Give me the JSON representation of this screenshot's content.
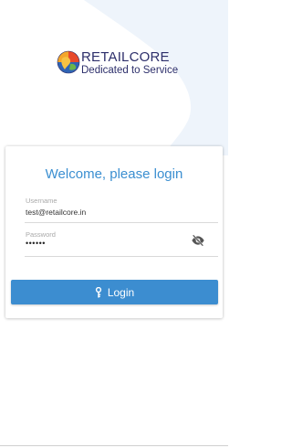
{
  "brand": {
    "name": "RETAILCORE",
    "tagline": "Dedicated to Service"
  },
  "login": {
    "title": "Welcome, please login",
    "username_label": "Username",
    "username_value": "test@retailcore.in",
    "password_label": "Password",
    "password_masked": "••••••",
    "button_label": "Login"
  },
  "icons": {
    "logo": "retailcore-globe-logo",
    "visibility_toggle": "eye-off-icon",
    "button_icon": "key-icon"
  },
  "colors": {
    "accent": "#3c8dd0",
    "title": "#3b8fd1",
    "brand_text": "#2d2f6b",
    "background_blob": "#eef4fb"
  }
}
